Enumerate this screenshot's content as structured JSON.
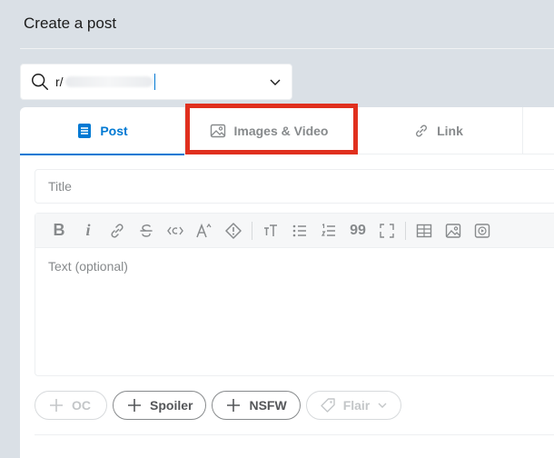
{
  "page": {
    "title": "Create a post"
  },
  "community": {
    "prefix": "r/"
  },
  "tabs": [
    {
      "label": "Post",
      "icon": "post-icon",
      "active": true
    },
    {
      "label": "Images & Video",
      "icon": "image-icon",
      "active": false
    },
    {
      "label": "Link",
      "icon": "link-icon",
      "active": false
    }
  ],
  "title_field": {
    "placeholder": "Title"
  },
  "editor": {
    "placeholder": "Text (optional)",
    "toolbar": [
      "bold-icon",
      "italic-icon",
      "link-icon",
      "strikethrough-icon",
      "inline-code-icon",
      "superscript-icon",
      "spoiler-icon",
      "heading-icon",
      "bulleted-list-icon",
      "numbered-list-icon",
      "quote-block-icon",
      "code-block-icon",
      "table-icon",
      "image-icon",
      "video-icon"
    ]
  },
  "tags": [
    {
      "label": "OC",
      "icon": "plus-icon",
      "disabled": true
    },
    {
      "label": "Spoiler",
      "icon": "plus-icon",
      "disabled": false
    },
    {
      "label": "NSFW",
      "icon": "plus-icon",
      "disabled": false
    },
    {
      "label": "Flair",
      "icon": "tag-icon",
      "disabled": true
    }
  ],
  "colors": {
    "accent": "#0079d3",
    "highlight": "#e0301e",
    "background": "#dae0e6",
    "muted": "#878a8c"
  }
}
